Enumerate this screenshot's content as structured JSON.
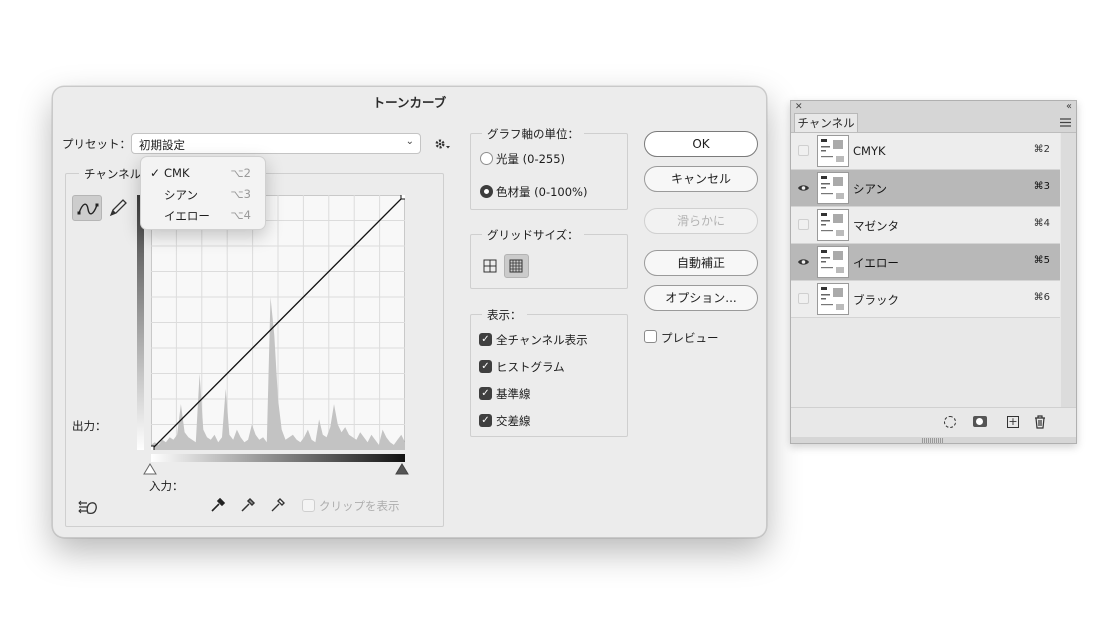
{
  "dialog": {
    "title": "トーンカーブ",
    "preset_label": "プリセット：",
    "preset_value": "初期設定",
    "channel_label": "チャンネル",
    "channel_menu": [
      {
        "label": "CMK",
        "shortcut": "⌥2",
        "checked": true
      },
      {
        "label": "シアン",
        "shortcut": "⌥3",
        "checked": false
      },
      {
        "label": "イエロー",
        "shortcut": "⌥4",
        "checked": false
      }
    ],
    "checkmark": "✓",
    "output_label": "出力：",
    "input_label": "入力：",
    "clip_label": "クリップを表示",
    "graph_units": {
      "legend": "グラフ軸の単位：",
      "options": [
        {
          "label": "光量 (0-255)",
          "selected": false
        },
        {
          "label": "色材量 (0-100%)",
          "selected": true
        }
      ]
    },
    "grid_size": {
      "legend": "グリッドサイズ：",
      "selected": "fine"
    },
    "display": {
      "legend": "表示：",
      "options": [
        {
          "label": "全チャンネル表示",
          "checked": true
        },
        {
          "label": "ヒストグラム",
          "checked": true
        },
        {
          "label": "基準線",
          "checked": true
        },
        {
          "label": "交差線",
          "checked": true
        }
      ]
    },
    "buttons": {
      "ok": "OK",
      "cancel": "キャンセル",
      "smooth": "滑らかに",
      "auto": "自動補正",
      "options": "オプション..."
    },
    "preview_label": "プレビュー",
    "preview_checked": false,
    "curve": {
      "points": [
        [
          0,
          0
        ],
        [
          100,
          100
        ]
      ],
      "histogram": [
        2,
        3,
        2,
        4,
        3,
        5,
        4,
        6,
        18,
        7,
        5,
        4,
        3,
        30,
        8,
        5,
        4,
        6,
        3,
        5,
        24,
        6,
        4,
        8,
        5,
        3,
        4,
        10,
        6,
        4,
        5,
        3,
        60,
        45,
        20,
        8,
        4,
        5,
        6,
        4,
        3,
        5,
        8,
        4,
        3,
        12,
        6,
        5,
        9,
        18,
        10,
        7,
        9,
        6,
        5,
        4,
        7,
        5,
        3,
        6,
        4,
        2,
        8,
        5,
        3,
        2,
        4,
        6,
        3
      ]
    }
  },
  "panel": {
    "tab": "チャンネル",
    "channels": [
      {
        "name": "CMYK",
        "shortcut": "⌘2",
        "visible": false,
        "selected": false
      },
      {
        "name": "シアン",
        "shortcut": "⌘3",
        "visible": true,
        "selected": true
      },
      {
        "name": "マゼンタ",
        "shortcut": "⌘4",
        "visible": false,
        "selected": false
      },
      {
        "name": "イエロー",
        "shortcut": "⌘5",
        "visible": true,
        "selected": true
      },
      {
        "name": "ブラック",
        "shortcut": "⌘6",
        "visible": false,
        "selected": false
      }
    ]
  }
}
